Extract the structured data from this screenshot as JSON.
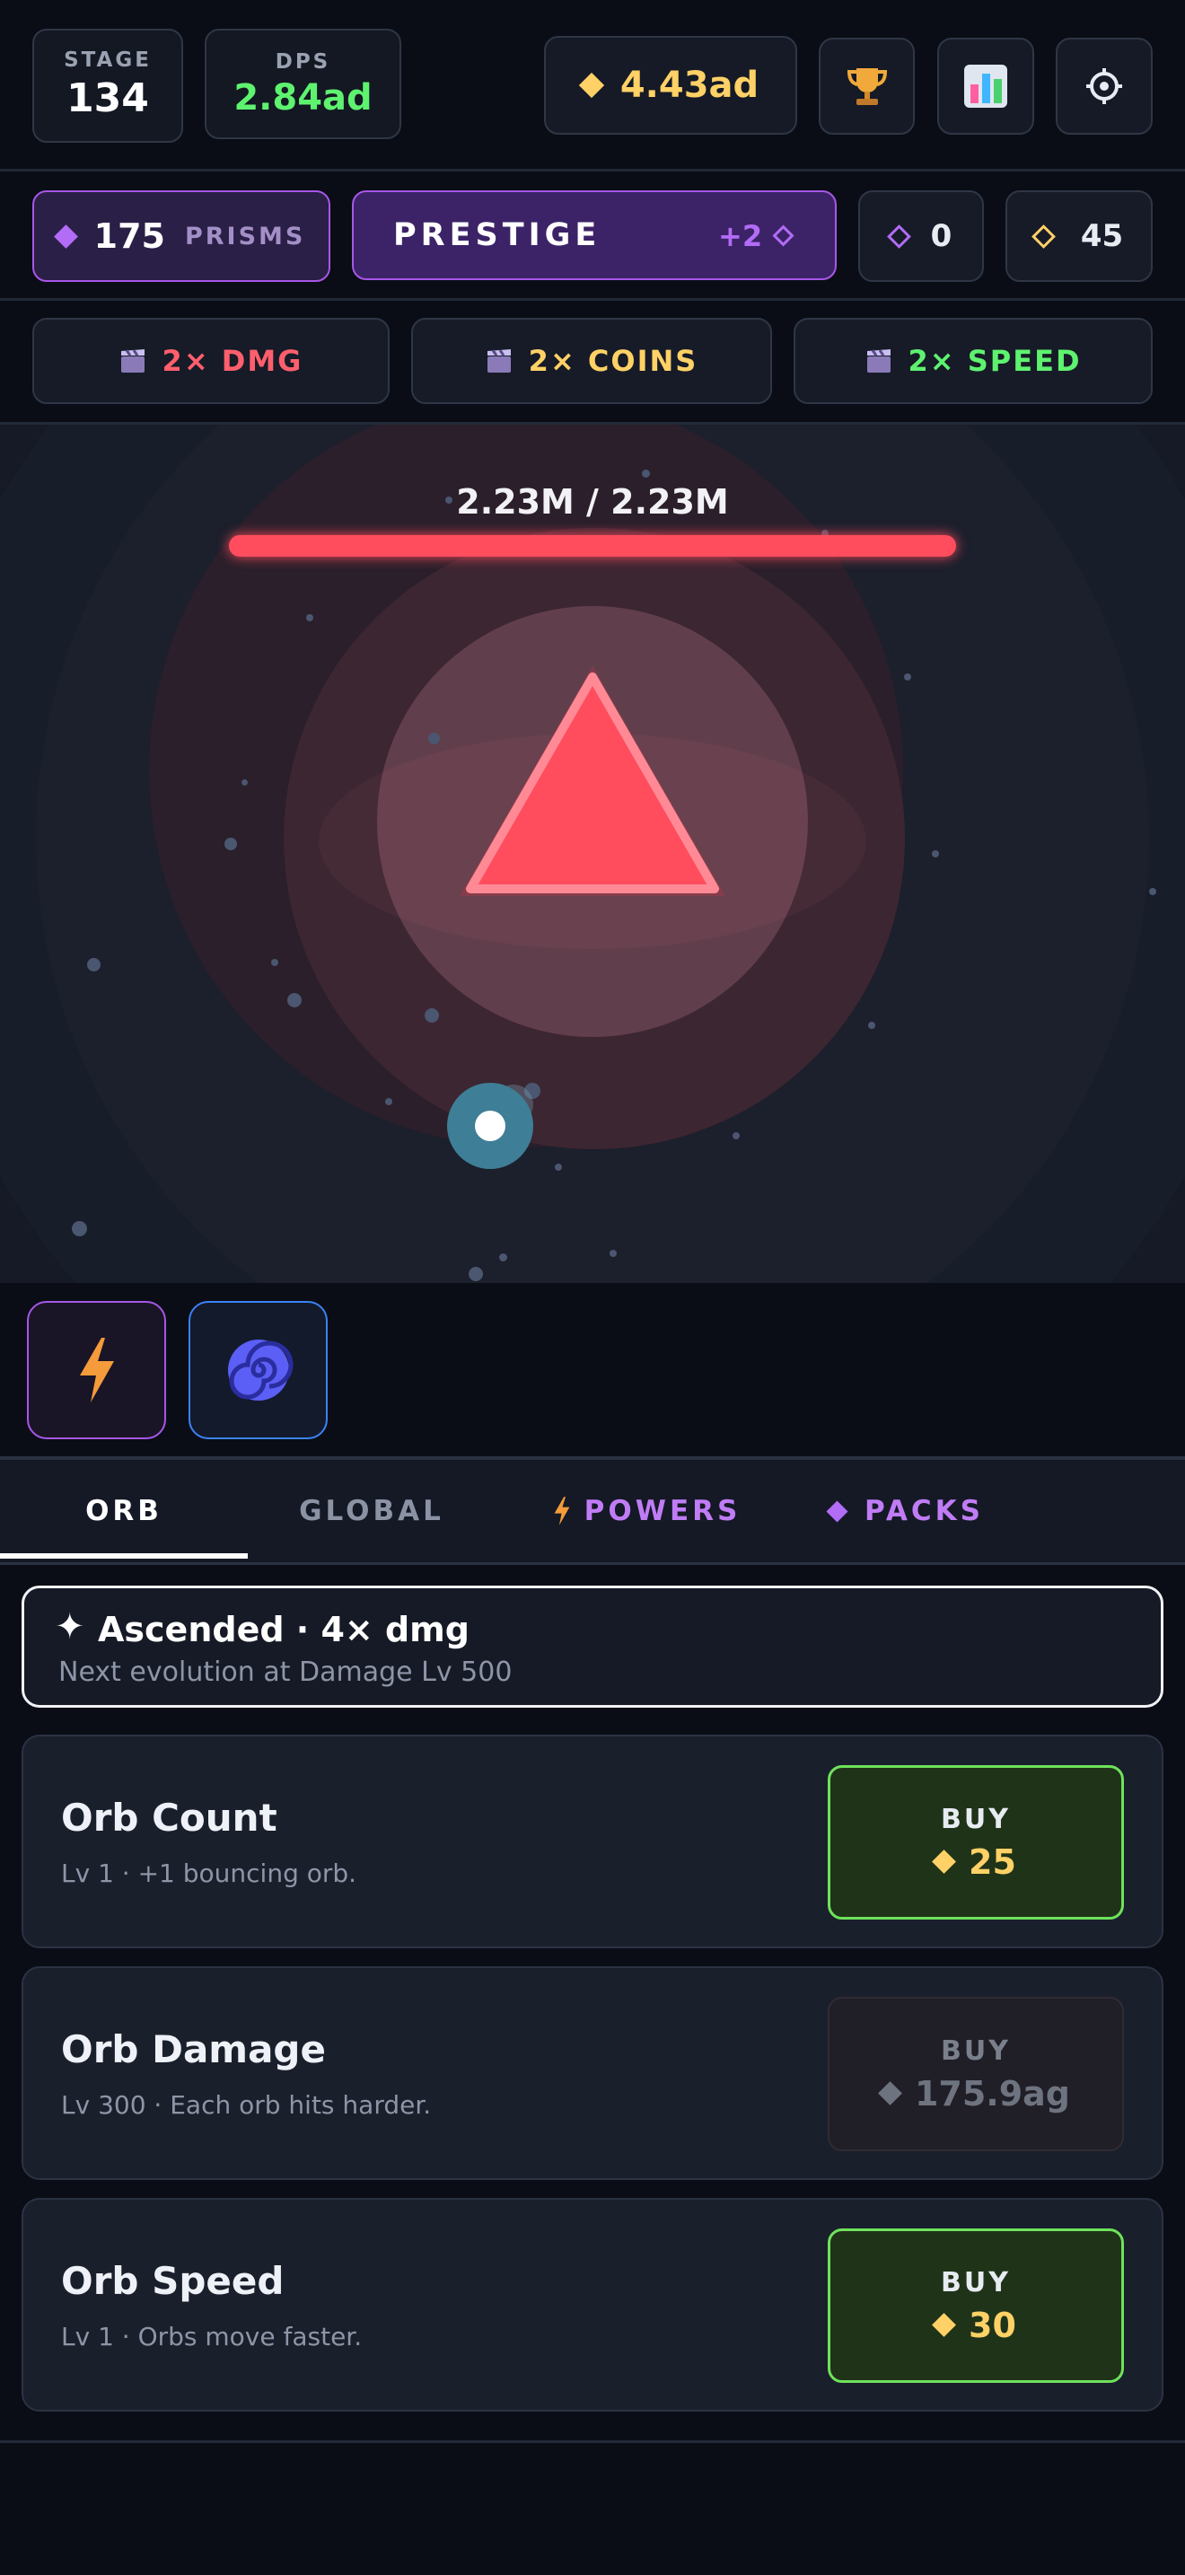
{
  "topbar": {
    "stage_label": "STAGE",
    "stage_value": "134",
    "dps_label": "DPS",
    "dps_value": "2.84ad",
    "coins_value": "4.43ad"
  },
  "currency_bar": {
    "prisms_value": "175",
    "prisms_label": "PRISMS",
    "prestige_label": "PRESTIGE",
    "prestige_gain": "+2",
    "purple_gem_count": "0",
    "gold_gem_count": "45"
  },
  "boosts": [
    {
      "label": "2× DMG",
      "color": "#ff5f6d"
    },
    {
      "label": "2× COINS",
      "color": "#ffd166"
    },
    {
      "label": "2× SPEED",
      "color": "#5ef26f"
    }
  ],
  "enemy": {
    "hp_text": "2.23M / 2.23M",
    "hp_fraction": 1.0,
    "shape": "triangle",
    "color": "#ff4d5e"
  },
  "abilities": [
    {
      "icon": "lightning-icon",
      "color": "#a757e8"
    },
    {
      "icon": "vortex-icon",
      "color": "#3b82f6"
    }
  ],
  "tabs": [
    {
      "label": "ORB",
      "active": true
    },
    {
      "label": "GLOBAL",
      "active": false
    },
    {
      "label": "POWERS",
      "active": false,
      "icon": "lightning-icon"
    },
    {
      "label": "PACKS",
      "active": false,
      "icon": "diamond-icon"
    }
  ],
  "evolution": {
    "title": "Ascended · 4× dmg",
    "subtitle": "Next evolution at Damage Lv 500"
  },
  "upgrades": [
    {
      "name": "Orb Count",
      "desc": "Lv 1 · +1 bouncing orb.",
      "buy_label": "BUY",
      "cost": "25",
      "affordable": true
    },
    {
      "name": "Orb Damage",
      "desc": "Lv 300 · Each orb hits harder.",
      "buy_label": "BUY",
      "cost": "175.9ag",
      "affordable": false
    },
    {
      "name": "Orb Speed",
      "desc": "Lv 1 · Orbs move faster.",
      "buy_label": "BUY",
      "cost": "30",
      "affordable": true
    }
  ]
}
